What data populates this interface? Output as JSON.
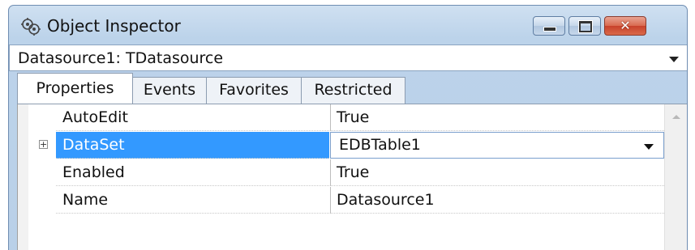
{
  "window": {
    "title": "Object Inspector",
    "icon": "object-inspector-icon",
    "controls": {
      "minimize": "minimize-icon",
      "maximize": "maximize-icon",
      "close_glyph": "✕"
    }
  },
  "component_selector": {
    "value": "Datasource1: TDatasource"
  },
  "tabs": [
    {
      "label": "Properties",
      "active": true
    },
    {
      "label": "Events",
      "active": false
    },
    {
      "label": "Favorites",
      "active": false
    },
    {
      "label": "Restricted",
      "active": false
    }
  ],
  "properties": [
    {
      "name": "AutoEdit",
      "value": "True",
      "expandable": false,
      "selected": false
    },
    {
      "name": "DataSet",
      "value": "EDBTable1",
      "expandable": true,
      "expand_glyph": "+",
      "selected": true,
      "editing": true
    },
    {
      "name": "Enabled",
      "value": "True",
      "expandable": false,
      "selected": false
    },
    {
      "name": "Name",
      "value": "Datasource1",
      "expandable": false,
      "selected": false
    }
  ],
  "colors": {
    "selection": "#3399ff",
    "title_bar": "#bcd3ea",
    "close_button": "#c8412b"
  }
}
